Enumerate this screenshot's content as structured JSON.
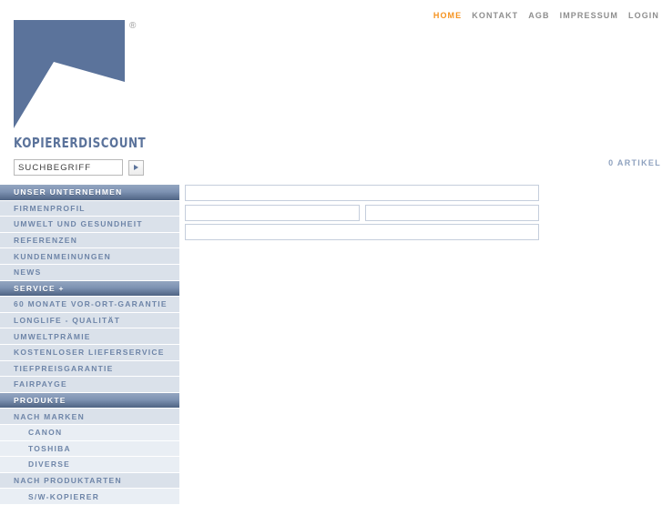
{
  "topnav": {
    "items": [
      {
        "label": "HOME",
        "active": true
      },
      {
        "label": "KONTAKT",
        "active": false
      },
      {
        "label": "AGB",
        "active": false
      },
      {
        "label": "IMPRESSUM",
        "active": false
      },
      {
        "label": "LOGIN",
        "active": false
      }
    ]
  },
  "logo": {
    "wordmark": "KOPIERERDISCOUNT",
    "registered_symbol": "®",
    "color": "#5b739b"
  },
  "search": {
    "placeholder": "SUCHBEGRIFF",
    "value": "",
    "submit_icon": "play-triangle-icon"
  },
  "cart": {
    "label": "0 ARTIKEL",
    "count": 0,
    "color": "#8fa2bf"
  },
  "sidebar": {
    "items": [
      {
        "label": "UNSER UNTERNEHMEN",
        "type": "header"
      },
      {
        "label": "FIRMENPROFIL",
        "type": "item"
      },
      {
        "label": "UMWELT UND GESUNDHEIT",
        "type": "item"
      },
      {
        "label": "REFERENZEN",
        "type": "item"
      },
      {
        "label": "KUNDENMEINUNGEN",
        "type": "item"
      },
      {
        "label": "NEWS",
        "type": "item"
      },
      {
        "label": "SERVICE +",
        "type": "header"
      },
      {
        "label": "60 MONATE VOR-ORT-GARANTIE",
        "type": "item"
      },
      {
        "label": "LONGLIFE - QUALITÄT",
        "type": "item"
      },
      {
        "label": "UMWELTPRÄMIE",
        "type": "item"
      },
      {
        "label": "KOSTENLOSER LIEFERSERVICE",
        "type": "item"
      },
      {
        "label": "TIEFPREISGARANTIE",
        "type": "item"
      },
      {
        "label": "FAIRPAYGE",
        "type": "item"
      },
      {
        "label": "PRODUKTE",
        "type": "header"
      },
      {
        "label": "NACH MARKEN",
        "type": "item"
      },
      {
        "label": "CANON",
        "type": "sub"
      },
      {
        "label": "TOSHIBA",
        "type": "sub"
      },
      {
        "label": "DIVERSE",
        "type": "sub"
      },
      {
        "label": "NACH PRODUKTARTEN",
        "type": "item"
      },
      {
        "label": "S/W-KOPIERER",
        "type": "sub"
      }
    ]
  },
  "main": {
    "form_rows": [
      {
        "fields": [
          {
            "width": "full",
            "value": "",
            "placeholder": ""
          }
        ]
      },
      {
        "fields": [
          {
            "width": "half",
            "value": "",
            "placeholder": ""
          },
          {
            "width": "half",
            "value": "",
            "placeholder": ""
          }
        ]
      },
      {
        "fields": [
          {
            "width": "full",
            "value": "",
            "placeholder": ""
          }
        ]
      }
    ]
  }
}
